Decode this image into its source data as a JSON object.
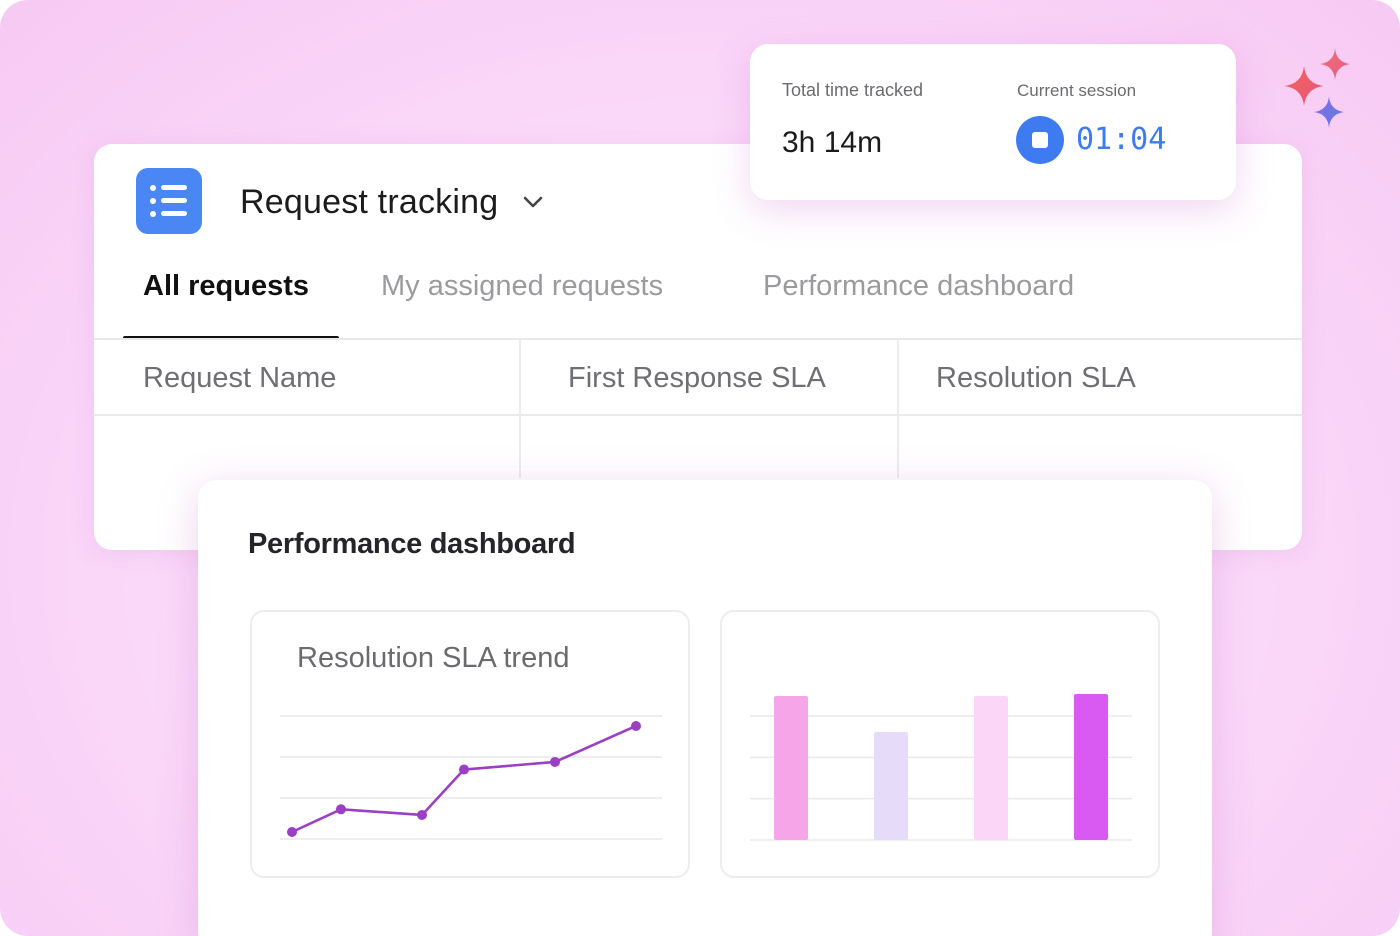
{
  "app": {
    "title": "Request tracking",
    "icon": "list-icon",
    "accent": "#4a87f5"
  },
  "tabs": [
    {
      "label": "All requests",
      "active": true
    },
    {
      "label": "My assigned requests",
      "active": false
    },
    {
      "label": "Performance dashboard",
      "active": false
    }
  ],
  "table": {
    "columns": [
      "Request Name",
      "First Response SLA",
      "Resolution SLA"
    ]
  },
  "timer": {
    "total_label": "Total time tracked",
    "total_value": "3h 14m",
    "session_label": "Current session",
    "session_value": "01:04",
    "stop_icon": "stop-icon",
    "color": "#3e7bf0"
  },
  "dashboard": {
    "title": "Performance dashboard",
    "line_panel_title": "Resolution SLA trend"
  },
  "chart_data": [
    {
      "type": "line",
      "title": "Resolution SLA trend",
      "x": [
        1,
        2,
        3,
        4,
        5,
        6
      ],
      "values": [
        1.0,
        1.6,
        1.45,
        2.65,
        2.85,
        3.8
      ],
      "ylim": [
        0,
        4
      ],
      "grid": true,
      "color": "#9b3fc4"
    },
    {
      "type": "bar",
      "categories": [
        "",
        "",
        "",
        ""
      ],
      "values": [
        3.6,
        2.7,
        3.6,
        3.65
      ],
      "ylim": [
        0,
        4
      ],
      "grid": true,
      "colors": [
        "#f6a5e8",
        "#e6dcfa",
        "#fcd6f7",
        "#d95af2"
      ]
    }
  ]
}
